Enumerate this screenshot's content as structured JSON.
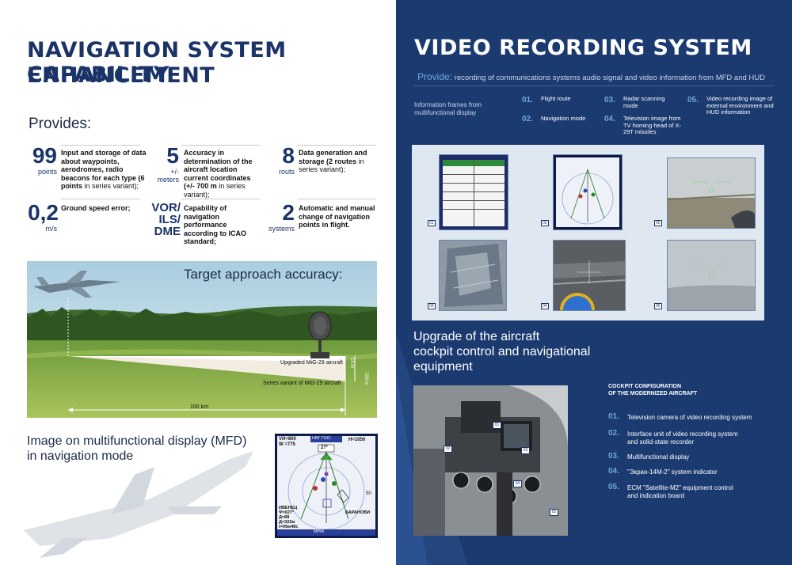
{
  "left": {
    "title_line1": "NAVIGATION SYSTEM CAPABILITY",
    "title_line2": "ENHANCEMENT",
    "provides_label": "Provides:",
    "stats": [
      {
        "number": "99",
        "unit": "points",
        "text_bold": "Input and storage of data about waypoints, aerodromes, radio beacons for each type (6 points",
        "text": "in series variant);"
      },
      {
        "number": "5",
        "unit": "+/- meters",
        "text_bold": "Accuracy in determination of the aircraft location current coordinates (+/- 700 m",
        "text": "in series variant);"
      },
      {
        "number": "8",
        "unit": "routs",
        "text_bold": "Data generation and storage (2 routes",
        "text": "in series variant);"
      },
      {
        "number": "0,2",
        "unit": "m/s",
        "text_bold": "Ground speed error;",
        "text": ""
      },
      {
        "number": "VOR/ ILS/ DME",
        "unit": "",
        "text_bold": "Capability of navigation performance according to ICAO standard;",
        "text": ""
      },
      {
        "number": "2",
        "unit": "systems",
        "text_bold": "Automatic and manual change of navigation points in flight.",
        "text": ""
      }
    ],
    "accuracy_title": "Target approach accuracy:",
    "upgraded_label": "Upgraded MiG-29 aircraft",
    "series_label": "Series variant of MiG-29 aircraft",
    "dist_label": "100 km",
    "h_small": "15 m",
    "h_big": "700 m",
    "mfd_caption_1": "Image on multifunctional display (MFD)",
    "mfd_caption_2": "in navigation mode",
    "mfd": {
      "tl1": "VИ=800",
      "tl2": "W =775",
      "top_center": "НВГ ГЕО",
      "heading": "27°",
      "tr": "H=1050",
      "r50": "50",
      "bl1": "ИВЕНЕЦ",
      "bl2": "Ψ=027°",
      "bl3": "Д=88",
      "bl4": "Д=322м",
      "bl5": "t=06м48с",
      "br": "БАРАНОВИ",
      "bottom": "МРМ"
    }
  },
  "right": {
    "title": "VIDEO RECORDING SYSTEM",
    "provide_key": "Provide:",
    "provide_text": "recording of communications systems audio signal and video information from MFD and HUD",
    "frames_note": "Information frames from multifunctional display",
    "items": [
      {
        "num": "01.",
        "text": "Flight route"
      },
      {
        "num": "02.",
        "text": "Navigation mode"
      },
      {
        "num": "03.",
        "text": "Radar scanning mode"
      },
      {
        "num": "04.",
        "text": "Television image from TV homing head of X-29T missiles"
      },
      {
        "num": "05.",
        "text": "Video recording image of external environment and HUD information"
      }
    ],
    "tile_labels": [
      "01",
      "02",
      "05",
      "03",
      "04",
      "05"
    ],
    "upgrade_1": "Upgrade of the aircraft",
    "upgrade_2": "cockpit control and navigational",
    "upgrade_3": "equipment",
    "cockpit_title_1": "COCKPIT CONFIGURATION",
    "cockpit_title_2": "OF THE MODERNIZED AIRCRAFT",
    "cockpit_items": [
      {
        "num": "01.",
        "text": "Television camera of video recording system"
      },
      {
        "num": "02.",
        "text": "Interface unit of video recording system and solid-state recorder"
      },
      {
        "num": "03.",
        "text": "Multifunctional display"
      },
      {
        "num": "04.",
        "text": "\"Экран-14М-2\" system indicator"
      },
      {
        "num": "05.",
        "text": "ECM \"Satellite-M2\" equipment control and indication board"
      }
    ],
    "photo_badges": [
      "01",
      "02",
      "03",
      "04",
      "05"
    ],
    "colors": {
      "accent": "#6fa8dc",
      "navy": "#1b3a70",
      "title_blue": "#1b3468"
    }
  }
}
